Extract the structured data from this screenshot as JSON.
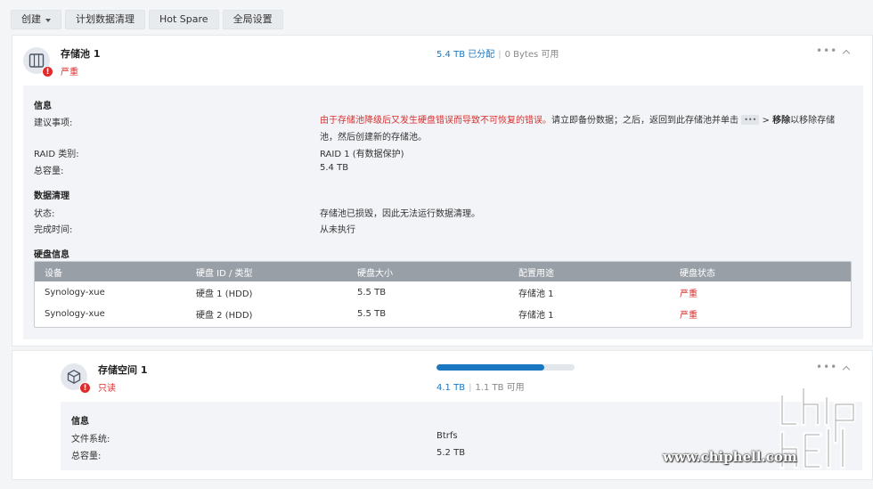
{
  "toolbar": {
    "create": "创建",
    "scrub_schedule": "计划数据清理",
    "hot_spare": "Hot Spare",
    "global_settings": "全局设置"
  },
  "pool": {
    "title": "存储池 1",
    "status": "严重",
    "allocated": "5.4 TB 已分配",
    "available": "0 Bytes 可用",
    "info_title": "信息",
    "advice_label": "建议事项:",
    "advice_red": "由于存储池降级后又发生硬盘错误而导致不可恢复的错误。",
    "advice_text1": "请立即备份数据；之后，返回到此存储池并单击",
    "advice_dots": "•••",
    "advice_gt": " > ",
    "advice_bold": "移除",
    "advice_text2": "以移除存储池，然后创建新的存储池。",
    "raid_label": "RAID 类别:",
    "raid_value": "RAID 1 (有数据保护)",
    "capacity_label": "总容量:",
    "capacity_value": "5.4 TB",
    "scrub_title": "数据清理",
    "scrub_status_label": "状态:",
    "scrub_status_value": "存储池已损毁，因此无法运行数据清理。",
    "scrub_time_label": "完成时间:",
    "scrub_time_value": "从未执行",
    "disk_title": "硬盘信息",
    "table": {
      "headers": [
        "设备",
        "硬盘 ID / 类型",
        "硬盘大小",
        "配置用途",
        "硬盘状态"
      ],
      "rows": [
        [
          "Synology-xue",
          "硬盘 1 (HDD)",
          "5.5 TB",
          "存储池 1",
          "严重"
        ],
        [
          "Synology-xue",
          "硬盘 2 (HDD)",
          "5.5 TB",
          "存储池 1",
          "严重"
        ]
      ]
    }
  },
  "volume": {
    "title": "存储空间 1",
    "status": "只读",
    "used": "4.1 TB",
    "available": "1.1 TB 可用",
    "usage_fraction": 0.78,
    "info_title": "信息",
    "fs_label": "文件系统:",
    "fs_value": "Btrfs",
    "capacity_label": "总容量:",
    "capacity_value": "5.2 TB"
  },
  "watermark": {
    "url": "www.chiphell.com"
  },
  "colors": {
    "accent": "#1a78c2",
    "danger": "#d9302f",
    "table_header": "#989fa7"
  }
}
